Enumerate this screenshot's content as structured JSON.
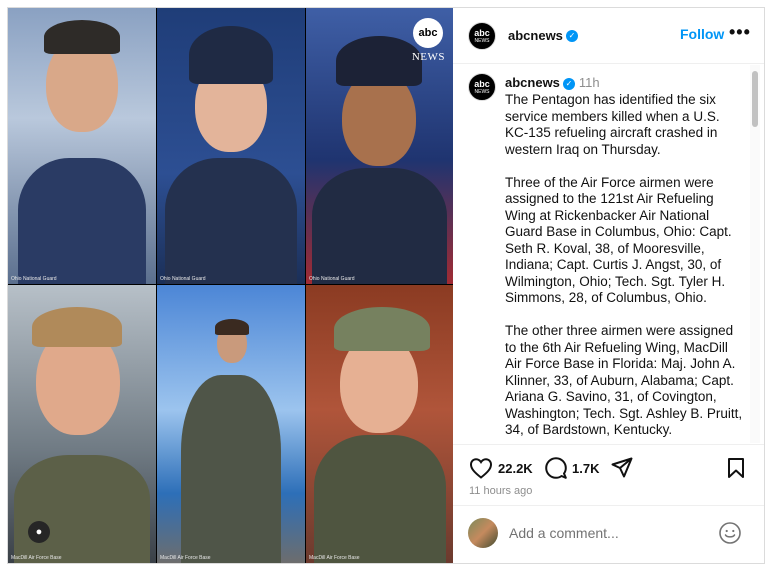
{
  "post": {
    "photo_credits": [
      "Ohio National Guard",
      "Ohio National Guard",
      "Ohio National Guard",
      "MacDill Air Force Base",
      "MacDill Air Force Base",
      "MacDill Air Force Base"
    ],
    "watermark": {
      "logo": "abc",
      "text": "NEWS"
    }
  },
  "header": {
    "username": "abcnews",
    "logo_top": "abc",
    "logo_bottom": "NEWS",
    "follow_label": "Follow",
    "more_label": "•••"
  },
  "caption": {
    "username": "abcnews",
    "time": "11h",
    "text": "The Pentagon has identified the six service members killed when a U.S. KC-135 refueling aircraft crashed in western Iraq on Thursday.\n\nThree of the Air Force airmen were assigned to the 121st Air Refueling Wing at Rickenbacker Air National Guard Base in Columbus, Ohio: Capt. Seth R. Koval, 38, of Mooresville, Indiana; Capt. Curtis J. Angst, 30, of Wilmington, Ohio; Tech. Sgt. Tyler H. Simmons, 28, of Columbus, Ohio.\n\nThe other three airmen were assigned to the 6th Air Refueling Wing, MacDill Air Force Base in Florida: Maj. John A. Klinner, 33, of Auburn, Alabama; Capt. Ariana G. Savino, 31, of Covington, Washington; Tech. Sgt. Ashley B. Pruitt, 34, of Bardstown, Kentucky."
  },
  "actions": {
    "likes": "22.2K",
    "comments": "1.7K",
    "posted": "11 hours ago"
  },
  "composer": {
    "placeholder": "Add a comment..."
  },
  "colors": {
    "accent": "#0095f6",
    "muted": "#8e8e8e"
  }
}
